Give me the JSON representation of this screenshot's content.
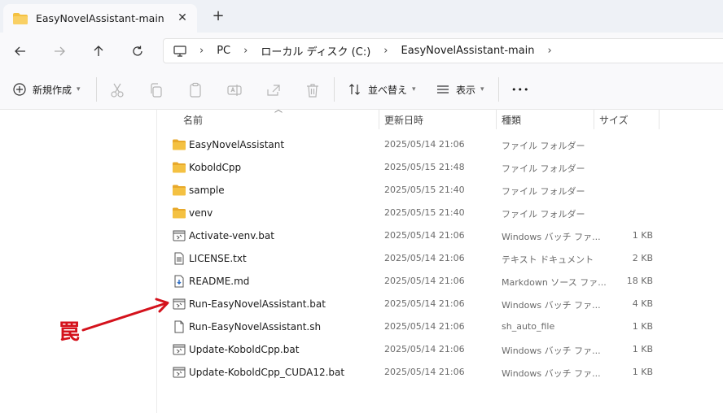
{
  "window": {
    "tab_title": "EasyNovelAssistant-main",
    "tab_close": "✕",
    "new_tab": "+"
  },
  "nav": {
    "back_icon": "←",
    "forward_icon": "→",
    "up_icon": "↑",
    "refresh_icon": "↻"
  },
  "breadcrumb": {
    "items": [
      "PC",
      "ローカル ディスク (C:)",
      "EasyNovelAssistant-main"
    ],
    "sep": "›"
  },
  "commands": {
    "new": "新規作成",
    "sort": "並べ替え",
    "view": "表示",
    "more": "•••"
  },
  "columns": {
    "name": "名前",
    "modified": "更新日時",
    "type": "種類",
    "size": "サイズ"
  },
  "files": [
    {
      "name": "EasyNovelAssistant",
      "date": "2025/05/14 21:06",
      "type": "ファイル フォルダー",
      "size": "",
      "icon": "folder"
    },
    {
      "name": "KoboldCpp",
      "date": "2025/05/15 21:48",
      "type": "ファイル フォルダー",
      "size": "",
      "icon": "folder"
    },
    {
      "name": "sample",
      "date": "2025/05/15 21:40",
      "type": "ファイル フォルダー",
      "size": "",
      "icon": "folder"
    },
    {
      "name": "venv",
      "date": "2025/05/15 21:40",
      "type": "ファイル フォルダー",
      "size": "",
      "icon": "folder"
    },
    {
      "name": "Activate-venv.bat",
      "date": "2025/05/14 21:06",
      "type": "Windows バッチ ファ...",
      "size": "1 KB",
      "icon": "bat"
    },
    {
      "name": "LICENSE.txt",
      "date": "2025/05/14 21:06",
      "type": "テキスト ドキュメント",
      "size": "2 KB",
      "icon": "txt"
    },
    {
      "name": "README.md",
      "date": "2025/05/14 21:06",
      "type": "Markdown ソース ファ...",
      "size": "18 KB",
      "icon": "md"
    },
    {
      "name": "Run-EasyNovelAssistant.bat",
      "date": "2025/05/14 21:06",
      "type": "Windows バッチ ファ...",
      "size": "4 KB",
      "icon": "bat"
    },
    {
      "name": "Run-EasyNovelAssistant.sh",
      "date": "2025/05/14 21:06",
      "type": "sh_auto_file",
      "size": "1 KB",
      "icon": "file"
    },
    {
      "name": "Update-KoboldCpp.bat",
      "date": "2025/05/14 21:06",
      "type": "Windows バッチ ファ...",
      "size": "1 KB",
      "icon": "bat"
    },
    {
      "name": "Update-KoboldCpp_CUDA12.bat",
      "date": "2025/05/14 21:06",
      "type": "Windows バッチ ファ...",
      "size": "1 KB",
      "icon": "bat"
    }
  ],
  "annotation": {
    "char": "罠",
    "color": "#d4121c"
  },
  "colors": {
    "folder": "#f4c142",
    "accent": "#0067c0"
  }
}
